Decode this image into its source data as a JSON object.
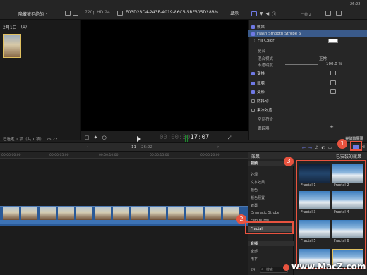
{
  "browser": {
    "library_menu": "隐藏被拒绝的",
    "event_date": "2月1日",
    "event_count": "(1)",
    "selection_status": "已选定 1 项（共 1 项）, 26:22"
  },
  "viewer": {
    "format": "720p HD 24...",
    "clip_name": "F03D28D4-243E-4019-86C6-5BF305D2...",
    "zoom": "88%",
    "display_menu": "显示",
    "timecode_dim": "00:00:00",
    "timecode": "17:07"
  },
  "inspector": {
    "frame_label": "一帧 2",
    "duration": "26:22",
    "sections": [
      {
        "label": "效果",
        "checked": true
      },
      {
        "label": "Flash Smooth Strobe 6",
        "checked": true
      },
      {
        "label": "Fill Color",
        "checked": false
      },
      {
        "label": "复合",
        "checked": false
      },
      {
        "label": "混合模式",
        "checked": false
      },
      {
        "label": "不透明度",
        "checked": false
      },
      {
        "label": "变换",
        "checked": true
      },
      {
        "label": "裁剪",
        "checked": true
      },
      {
        "label": "变形",
        "checked": true
      },
      {
        "label": "防抖动",
        "checked": false
      },
      {
        "label": "果冻效应",
        "checked": false
      },
      {
        "label": "空间符合",
        "checked": false
      },
      {
        "label": "跟踪器",
        "checked": false
      }
    ],
    "blend_mode_value": "正常",
    "opacity_value": "100.0 %",
    "save_preset": "存储效果预置"
  },
  "timeline": {
    "index": "11",
    "time": "26:22",
    "ruler_ticks": [
      "00:00:00:00",
      "00:00:05:00",
      "00:00:10:00",
      "00:00:15:00",
      "00:00:20:00"
    ]
  },
  "effects_browser": {
    "title": "效果",
    "installed_label": "已安装的效果",
    "categories": [
      {
        "label": "视频",
        "header": true
      },
      {
        "label": "外观",
        "header": false
      },
      {
        "label": "文本效果",
        "header": false
      },
      {
        "label": "颜色",
        "header": false
      },
      {
        "label": "颜色预置",
        "header": false
      },
      {
        "label": "遮罩",
        "header": false
      },
      {
        "label": "Dramatic Strobe",
        "header": false
      },
      {
        "label": "Film Burns",
        "header": false
      },
      {
        "label": "Fractal",
        "header": false
      },
      {
        "label": "音频",
        "header": true
      },
      {
        "label": "全部",
        "header": false
      },
      {
        "label": "电平",
        "header": false
      }
    ],
    "tiles": [
      "Fractal 1",
      "Fractal 2",
      "Fractal 3",
      "Fractal 4",
      "Fractal 5",
      "Fractal 6",
      "",
      ""
    ],
    "item_count": "24",
    "search_placeholder": "搜索"
  },
  "callouts": [
    "1",
    "2",
    "3"
  ],
  "watermark": "www.MacZ.com",
  "colors": {
    "accent": "#6f79e4",
    "callout": "#e8533f",
    "clip": "#2a5a98"
  }
}
